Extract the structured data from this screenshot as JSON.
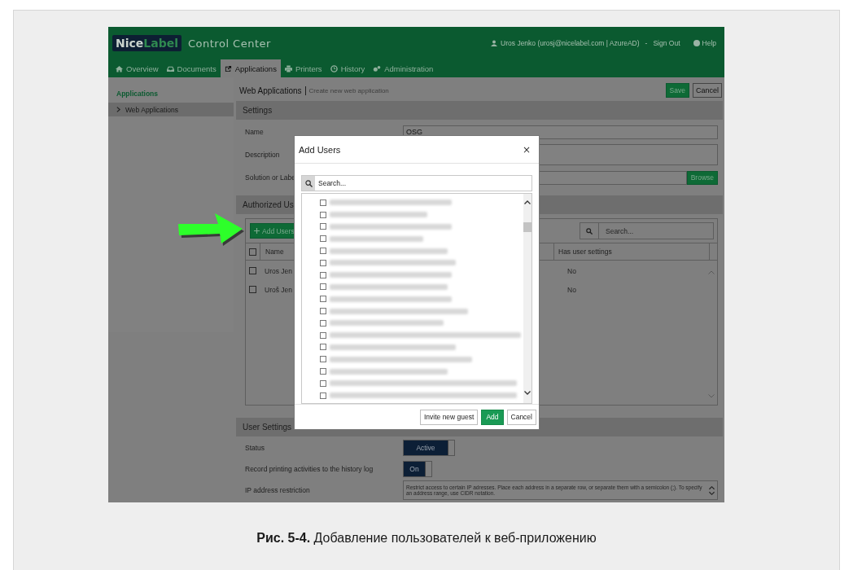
{
  "header": {
    "logo_part_1": "Nice",
    "logo_part_2": "Label",
    "product": "Control Center",
    "user": "Uros Jenko (urosj@nicelabel.com | AzureAD)",
    "separator": "-",
    "sign_out": "Sign Out",
    "help": "Help"
  },
  "tabs": [
    {
      "label": "Overview",
      "selected": false
    },
    {
      "label": "Documents",
      "selected": false
    },
    {
      "label": "Applications",
      "selected": true
    },
    {
      "label": "Printers",
      "selected": false
    },
    {
      "label": "History",
      "selected": false
    },
    {
      "label": "Administration",
      "selected": false
    }
  ],
  "sidebar": {
    "heading": "Applications",
    "items": [
      {
        "label": "Web Applications",
        "selected": true
      }
    ]
  },
  "page": {
    "title": "Web Applications",
    "subtitle": "Create new web application",
    "save": "Save",
    "cancel": "Cancel"
  },
  "settings": {
    "heading": "Settings",
    "fields": [
      {
        "label": "Name",
        "kind": "input",
        "value": "OSG"
      },
      {
        "label": "Description",
        "kind": "textarea"
      },
      {
        "label": "Solution or Labe",
        "kind": "browse",
        "button": "Browse"
      }
    ]
  },
  "authorized_users": {
    "heading": "Authorized Us",
    "add_button": "Add Users",
    "search_placeholder": "Search...",
    "header_checked": false,
    "columns": [
      "Name",
      "Has user settings"
    ],
    "rows": [
      {
        "checked": false,
        "name": "Uros Jen",
        "has_user_settings": "No"
      },
      {
        "checked": false,
        "name": "Uroš Jen",
        "has_user_settings": "No"
      }
    ]
  },
  "user_settings": {
    "heading": "User Settings",
    "rows": [
      {
        "label": "Status",
        "kind": "toggle",
        "value": "Active",
        "on": true
      },
      {
        "label": "Record printing activities to the history log",
        "kind": "toggle",
        "value": "On",
        "on": true
      },
      {
        "label": "IP address restriction",
        "kind": "textarea",
        "placeholder": "Restrict access to certain IP adresses. Place each address in a separate row, or separate them with a semicolon (;). To specify an address range, use CIDR notation."
      }
    ]
  },
  "dialog": {
    "title": "Add Users",
    "close": "×",
    "search_placeholder": "Search...",
    "users": [
      {
        "checked": false
      },
      {
        "checked": false
      },
      {
        "checked": false
      },
      {
        "checked": false
      },
      {
        "checked": false
      },
      {
        "checked": false
      },
      {
        "checked": false
      },
      {
        "checked": false
      },
      {
        "checked": false
      },
      {
        "checked": false
      },
      {
        "checked": false
      },
      {
        "checked": false
      },
      {
        "checked": false
      },
      {
        "checked": false
      },
      {
        "checked": false
      },
      {
        "checked": false
      },
      {
        "checked": false
      }
    ],
    "buttons": [
      {
        "label": "Invite new guest",
        "kind": "secondary"
      },
      {
        "label": "Add",
        "kind": "primary"
      },
      {
        "label": "Cancel",
        "kind": "secondary"
      }
    ]
  },
  "caption": "**Рис. 5-4.** Добавление пользователей к веб-приложению"
}
